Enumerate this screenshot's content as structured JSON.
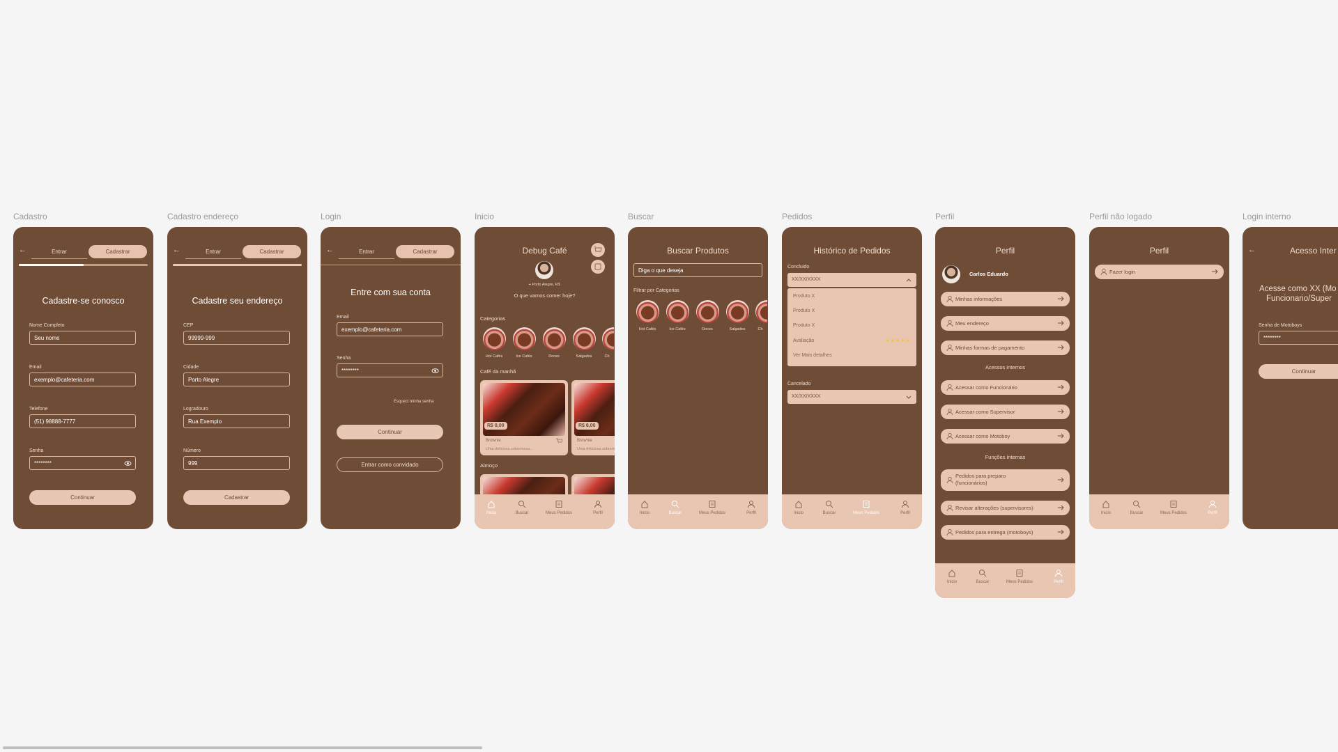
{
  "frames": {
    "cadastro": "Cadastro",
    "cadastro_endereco": "Cadastro endereço",
    "login": "Login",
    "inicio": "Inicio",
    "buscar": "Buscar",
    "pedidos": "Pedidos",
    "perfil": "Perfil",
    "perfil_nao_logado": "Perfil não logado",
    "login_interno": "Login interno"
  },
  "tabs": {
    "entrar": "Entrar",
    "cadastrar": "Cadastrar"
  },
  "cadastro": {
    "progress": 0.5,
    "title": "Cadastre-se conosco",
    "nome_label": "Nome Completo",
    "nome_value": "Seu nome",
    "email_label": "Email",
    "email_value": "exemplo@cafeteria.com",
    "telefone_label": "Telefone",
    "telefone_value": "(51) 98888-7777",
    "senha_label": "Senha",
    "senha_value": "********",
    "button": "Continuar"
  },
  "endereco": {
    "progress": 1.0,
    "title": "Cadastre seu endereço",
    "cep_label": "CEP",
    "cep_value": "99999-999",
    "cidade_label": "Cidade",
    "cidade_value": "Porto Alegre",
    "logradouro_label": "Logradouro",
    "logradouro_value": "Rua Exemplo",
    "numero_label": "Número",
    "numero_value": "999",
    "button": "Cadastrar"
  },
  "login": {
    "title": "Entre com sua conta",
    "email_label": "Email",
    "email_value": "exemplo@cafeteria.com",
    "senha_label": "Senha",
    "senha_value": "********",
    "forgot": "Esqueci minha senha",
    "button": "Continuar",
    "guest": "Entrar como convidado"
  },
  "inicio": {
    "title": "Debug Café",
    "location": "Porto Alegre, RS",
    "greeting": "O que vamos comer hoje?",
    "categorias_label": "Categorias",
    "cafe_label": "Café da manhã",
    "almoco_label": "Almoço",
    "card_price": "R$ 8,00",
    "card_name": "Brownie",
    "card_desc": "Uma deliciosa sobremesa..."
  },
  "categories": [
    "Hot Cafés",
    "Ice Cafés",
    "Doces",
    "Salgados",
    "Ch"
  ],
  "nav": {
    "inicio": "Inicio",
    "buscar": "Buscar",
    "pedidos": "Meus Pedidos",
    "perfil": "Perfil"
  },
  "buscar": {
    "title": "Buscar Produtos",
    "placeholder": "Diga o que deseja",
    "filter_label": "Filtrar por Categorias"
  },
  "pedidos": {
    "title": "Histórico de Pedidos",
    "concluido_label": "Concluido",
    "date": "XX/XX/XXXX",
    "produto_1": "Produto X",
    "produto_2": "Produto X",
    "produto_3": "Produto X",
    "avaliacao": "Avaliação",
    "stars": "★★★★★",
    "rating": 5,
    "ver_mais": "Ver Mais detalhes",
    "cancelado_label": "Cancelado",
    "cancelado_date": "XX/XX/XXXX"
  },
  "perfil": {
    "title": "Perfil",
    "user_name": "Carlos Eduardo",
    "items": [
      "Minhas informações",
      "Meu endereço",
      "Minhas formas de pagamento"
    ],
    "acessos_label": "Acessos internos",
    "acessos": [
      "Acessar como Funcionário",
      "Acessar como Supervisor",
      "Acessar como Motoboy"
    ],
    "funcoes_label": "Funções internas",
    "funcao_1_line1": "Pedidos para preparo",
    "funcao_1_line2": "(funcionários)",
    "funcao_2": "Revisar alterações (supervisores)",
    "funcao_3": "Pedidos para entrega (motoboys)"
  },
  "perfil_nao_logado": {
    "title": "Perfil",
    "login_button": "Fazer login"
  },
  "login_interno": {
    "title": "Acesso Inter",
    "heading_line1": "Acesse como XX (Mo",
    "heading_line2": "Funcionario/Super",
    "senha_label": "Senha de Motoboys",
    "senha_value": "********",
    "button": "Continuar"
  },
  "colors": {
    "brown": "#6f4c36",
    "beige": "#e8c6b2",
    "background": "#f5f5f5"
  }
}
